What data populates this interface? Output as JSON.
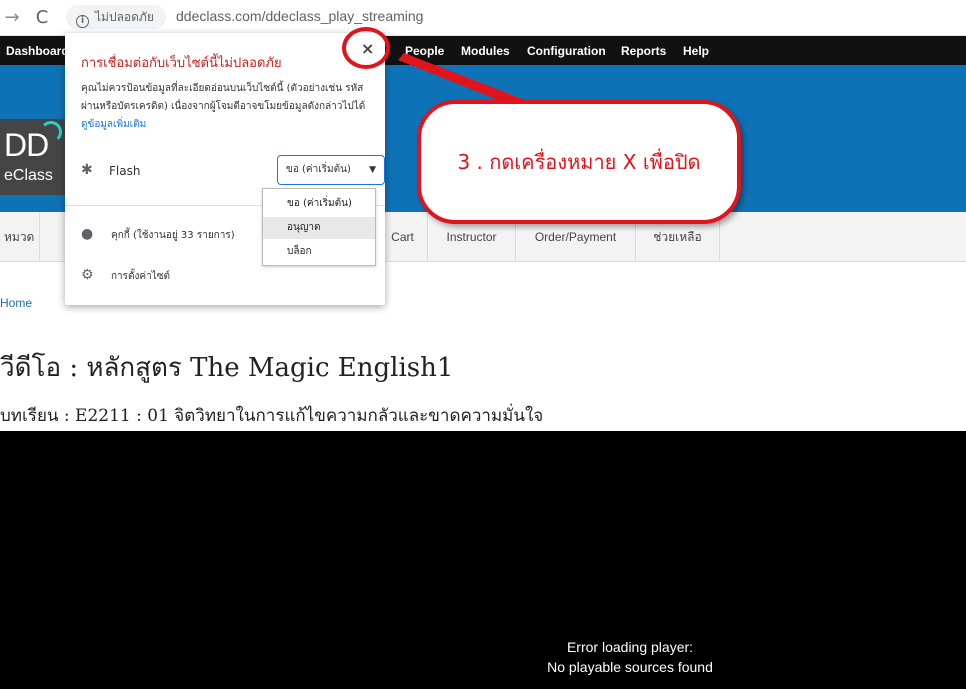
{
  "browser": {
    "forward_icon": "→",
    "reload_icon": "C",
    "security_label": "ไม่ปลอดภัย",
    "url": "ddeclass.com/ddeclass_play_streaming"
  },
  "admin_nav": {
    "items": [
      "Dashboard",
      "People",
      "Modules",
      "Configuration",
      "Reports",
      "Help"
    ]
  },
  "logo": {
    "primary": "DD",
    "secondary": "eClass"
  },
  "sub_menu": {
    "items": [
      "หมวด",
      "Cart",
      "Instructor",
      "Order/Payment",
      "ช่วยเหลือ"
    ]
  },
  "breadcrumb": "Home",
  "page_title": "วีดีโอ : หลักสูตร The Magic English1",
  "lesson_title": "บทเรียน : E2211 : 01 จิตวิทยาในการแก้ไขความกลัวและขาดความมั่นใจ",
  "player": {
    "error_line1": "Error loading player:",
    "error_line2": "No playable sources found"
  },
  "site_popup": {
    "title": "การเชื่อมต่อกับเว็บไซต์นี้ไม่ปลอดภัย",
    "close_label": "×",
    "description": "คุณไม่ควรป้อนข้อมูลที่ละเอียดอ่อนบนเว็บไซต์นี้ (ตัวอย่างเช่น รหัสผ่านหรือบัตรเครดิต) เนื่องจากผู้โจมตีอาจขโมยข้อมูลดังกล่าวไปได้",
    "learn_more": "ดูข้อมูลเพิ่มเติม",
    "flash_label": "Flash",
    "flash_value": "ขอ (ค่าเริ่มต้น)",
    "cookies_label": "คุกกี้ (ใช้งานอยู่ 33 รายการ)",
    "settings_label": "การตั้งค่าไซต์"
  },
  "permission_options": [
    "ขอ (ค่าเริ่มต้น)",
    "อนุญาต",
    "บล็อก"
  ],
  "annotation": {
    "text": "3 . กดเครื่องหมาย X เพื่อปิด",
    "color": "#e0141a"
  }
}
